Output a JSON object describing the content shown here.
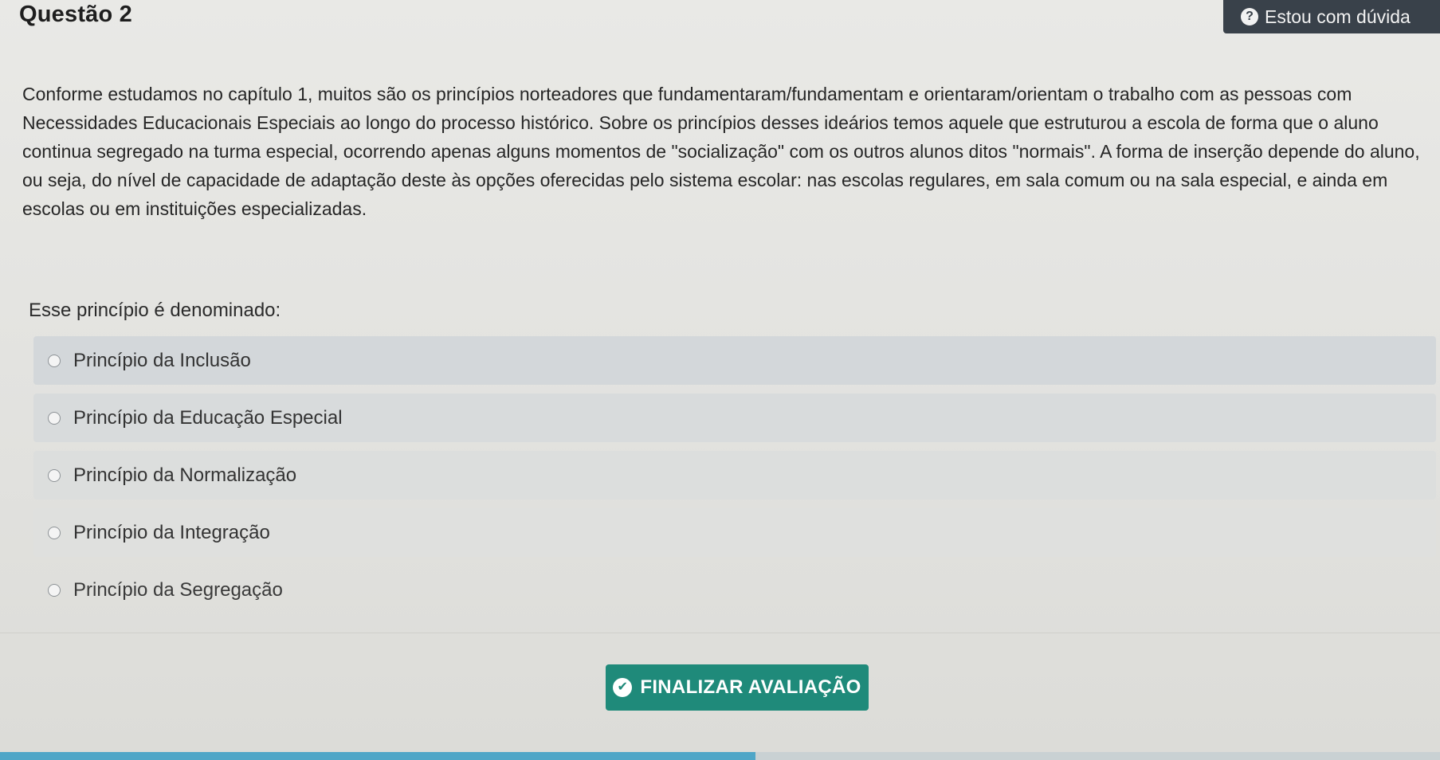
{
  "question": {
    "title": "Questão 2",
    "statement": "Conforme estudamos no capítulo 1, muitos são os princípios norteadores que fundamentaram/fundamentam e orientaram/orientam o trabalho com as pessoas com Necessidades Educacionais Especiais ao longo do processo histórico. Sobre os princípios desses ideários temos aquele que estruturou a escola de forma que o aluno continua segregado na turma especial, ocorrendo apenas alguns momentos de \"socialização\" com os outros alunos ditos \"normais\". A forma de inserção depende do aluno, ou seja, do nível de capacidade de adaptação deste às opções oferecidas pelo sistema escolar: nas escolas regulares, em sala comum ou na sala especial, e ainda em escolas ou em instituições especializadas.",
    "prompt": "Esse princípio é denominado:"
  },
  "help_button": {
    "label": "Estou com dúvida",
    "icon": "question-circle-icon"
  },
  "options": [
    {
      "label": "Princípio da Inclusão"
    },
    {
      "label": "Princípio da Educação Especial"
    },
    {
      "label": "Princípio da Normalização"
    },
    {
      "label": "Princípio da Integração"
    },
    {
      "label": "Princípio da Segregação"
    }
  ],
  "finish_button": {
    "label": "FINALIZAR AVALIAÇÃO",
    "icon": "check-circle-icon",
    "color": "#1f8a7a"
  },
  "colors": {
    "help_bg": "#39414a",
    "progress": "#4fa6c7"
  }
}
